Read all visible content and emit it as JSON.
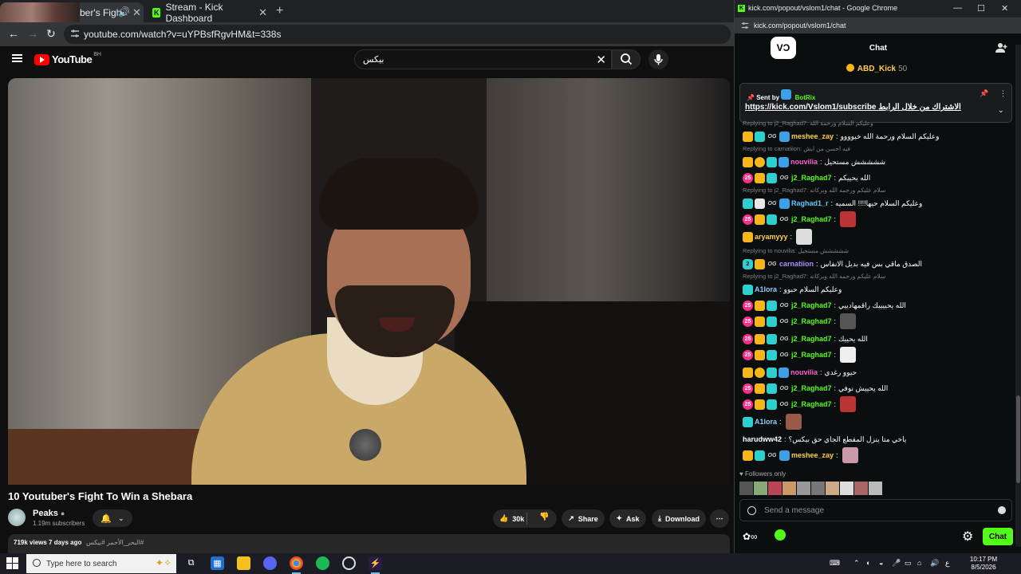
{
  "left_window": {
    "tabs": [
      {
        "label": "ber's Fight",
        "active": true
      },
      {
        "label": "Stream - Kick Dashboard",
        "active": false
      }
    ],
    "url": "youtube.com/watch?v=uYPBsfRgvHM&t=338s",
    "youtube": {
      "logo_text": "YouTube",
      "country_code": "BH",
      "search_query": "بيكس",
      "video_title": "10 Youtuber's Fight To Win a Shebara",
      "channel_name": "Peaks",
      "subscribers": "1.19m subscribers",
      "likes": "30k",
      "share_label": "Share",
      "ask_label": "Ask",
      "download_label": "Download",
      "views_date": "719k views  7 days ago",
      "hashtags": "#البحر_الأحمر #بيكس"
    }
  },
  "right_window": {
    "title": "kick.com/popout/vslom1/chat - Google Chrome",
    "url": "kick.com/popout/vslom1/chat",
    "chat_title": "Chat",
    "top_gifter": {
      "name": "ABD_Kick",
      "count": "50"
    },
    "pinned": {
      "sent_by_label": "Sent by",
      "sender": "BotRix",
      "link": "https://kick.com/Vslom1/subscribe",
      "text": "الاشتراك من خلال الرابط"
    },
    "messages": [
      {
        "reply": "Replying to j2_Raghad7: وعليكم السلام ورحمة الله",
        "user": "meshee_zay",
        "color": "#ffd24a",
        "badges": [
          "crown",
          "sub",
          "og",
          "bot"
        ],
        "text": "وعليكم السلام ورحمة الله خيوووو"
      },
      {
        "reply": "Replying to carnatiion: فيه احسن من ايش",
        "user": "nouvilia",
        "color": "#ff5bd1",
        "badges": [
          "crown",
          "coin",
          "sub",
          "bot"
        ],
        "text": "ششششش مستحيل"
      },
      {
        "reply": "",
        "user": "j2_Raghad7",
        "color": "#53fc18",
        "badges": [
          "gift",
          "crown",
          "sub",
          "og"
        ],
        "text": "الله يحييكم"
      },
      {
        "reply": "Replying to j2_Raghad7: سلام عليكم ورحمه الله وبركاته",
        "user": "Raghad1_r",
        "color": "#5ec9ff",
        "badges": [
          "sub",
          "red",
          "og",
          "bot"
        ],
        "text": "وعليكم السلام حيها!!!! السميه"
      },
      {
        "reply": "",
        "user": "j2_Raghad7",
        "color": "#53fc18",
        "badges": [
          "gift",
          "crown",
          "sub",
          "og"
        ],
        "text": "",
        "emote": "#b33"
      },
      {
        "reply": "",
        "user": "aryamyyy",
        "color": "#ffd24a",
        "badges": [
          "crown"
        ],
        "text": "",
        "emote": "#ddd"
      },
      {
        "reply": "Replying to nouvilia: ششششش مستحيل",
        "user": "carnatiion",
        "color": "#a78bfa",
        "badges": [
          "hex",
          "crown",
          "og"
        ],
        "text": "الصدق ماقي بس فيه بديل الانفاس"
      },
      {
        "reply": "Replying to j2_Raghad7: سلام عليكم ورحمه الله وبركاته",
        "user": "A1lora",
        "color": "#8ecbff",
        "badges": [
          "sub"
        ],
        "text": "وعليكم السلام حبوو"
      },
      {
        "reply": "",
        "user": "j2_Raghad7",
        "color": "#53fc18",
        "badges": [
          "gift",
          "crown",
          "sub",
          "og"
        ],
        "text": "الله يحييييك راقمهادييي"
      },
      {
        "reply": "",
        "user": "j2_Raghad7",
        "color": "#53fc18",
        "badges": [
          "gift",
          "crown",
          "sub",
          "og"
        ],
        "text": "",
        "emote": "#555"
      },
      {
        "reply": "",
        "user": "j2_Raghad7",
        "color": "#53fc18",
        "badges": [
          "gift",
          "crown",
          "sub",
          "og"
        ],
        "text": "الله يحييك"
      },
      {
        "reply": "",
        "user": "j2_Raghad7",
        "color": "#53fc18",
        "badges": [
          "gift",
          "crown",
          "sub",
          "og"
        ],
        "text": "",
        "emote": "#eee"
      },
      {
        "reply": "",
        "user": "nouvilia",
        "color": "#ff5bd1",
        "badges": [
          "crown",
          "coin",
          "sub",
          "bot"
        ],
        "text": "حيوو رغدي"
      },
      {
        "reply": "",
        "user": "j2_Raghad7",
        "color": "#53fc18",
        "badges": [
          "gift",
          "crown",
          "sub",
          "og"
        ],
        "text": "الله يحييش نوفي"
      },
      {
        "reply": "",
        "user": "j2_Raghad7",
        "color": "#53fc18",
        "badges": [
          "gift",
          "crown",
          "sub",
          "og"
        ],
        "text": "",
        "emote": "#b33"
      },
      {
        "reply": "",
        "user": "A1lora",
        "color": "#8ecbff",
        "badges": [
          "sub"
        ],
        "text": "",
        "emote": "#9a5a4a"
      },
      {
        "reply": "",
        "user": "harudww42",
        "color": "#ffffff",
        "badges": [],
        "text": "ياخي متا ينزل المقطع الجاي حق بيكس؟"
      },
      {
        "reply": "",
        "user": "meshee_zay",
        "color": "#ffd24a",
        "badges": [
          "crown",
          "sub",
          "og",
          "bot"
        ],
        "text": "",
        "emote": "#c9a"
      }
    ],
    "followers_only": "Followers only",
    "input_placeholder": "Send a message",
    "chat_button": "Chat"
  },
  "taskbar": {
    "search_placeholder": "Type here to search",
    "time": "10:17 PM",
    "date": "8/5/2026",
    "lang": "ع"
  }
}
